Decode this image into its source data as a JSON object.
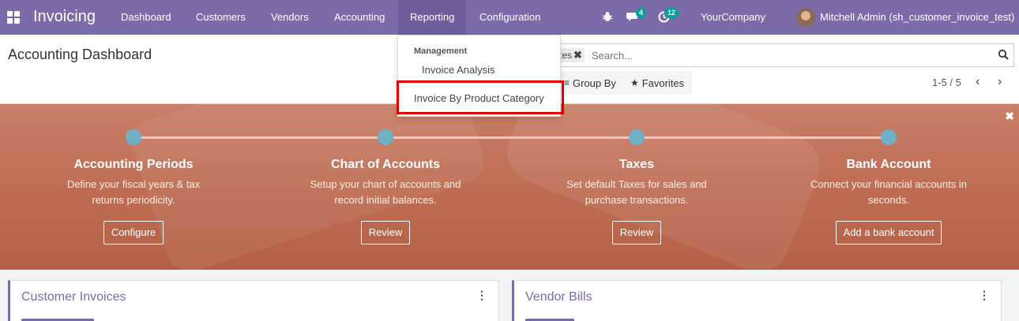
{
  "app": {
    "title": "Invoicing"
  },
  "nav": {
    "items": [
      {
        "label": "Dashboard"
      },
      {
        "label": "Customers"
      },
      {
        "label": "Vendors"
      },
      {
        "label": "Accounting"
      },
      {
        "label": "Reporting"
      },
      {
        "label": "Configuration"
      }
    ],
    "active": "Reporting"
  },
  "systray": {
    "bug_icon": "bug-icon",
    "messages_icon": "chat-icon",
    "messages_count": "4",
    "activities_icon": "clock-icon",
    "activities_count": "12",
    "company": "YourCompany",
    "user": "Mitchell Admin (sh_customer_invoice_test)"
  },
  "control_panel": {
    "title": "Accounting Dashboard",
    "search": {
      "facet_label": "tes",
      "placeholder": "Search..."
    },
    "group_by_label": "Group By",
    "favorites_label": "Favorites",
    "pager": "1-5 / 5"
  },
  "dropdown": {
    "section_header": "Management",
    "items": [
      "Invoice Analysis",
      "Invoice By Product Category"
    ],
    "highlighted_item": "Invoice By Product Category",
    "highlight_color": "#e00000"
  },
  "banner": {
    "steps": [
      {
        "title": "Accounting Periods",
        "desc_line1": "Define your fiscal years & tax",
        "desc_line2": "returns periodicity.",
        "button": "Configure"
      },
      {
        "title": "Chart of Accounts",
        "desc_line1": "Setup your chart of accounts and",
        "desc_line2": "record initial balances.",
        "button": "Review"
      },
      {
        "title": "Taxes",
        "desc_line1": "Set default Taxes for sales and",
        "desc_line2": "purchase transactions.",
        "button": "Review"
      },
      {
        "title": "Bank Account",
        "desc_line1": "Connect your financial accounts in",
        "desc_line2": "seconds.",
        "button": "Add a bank account"
      }
    ]
  },
  "cards": [
    {
      "title": "Customer Invoices"
    },
    {
      "title": "Vendor Bills"
    }
  ],
  "colors": {
    "navbar": "#7c6ba9",
    "accent": "#7c6ba9",
    "badge": "#00a09d",
    "banner": "#bd6c52",
    "step_dot": "#6fb0c7"
  }
}
